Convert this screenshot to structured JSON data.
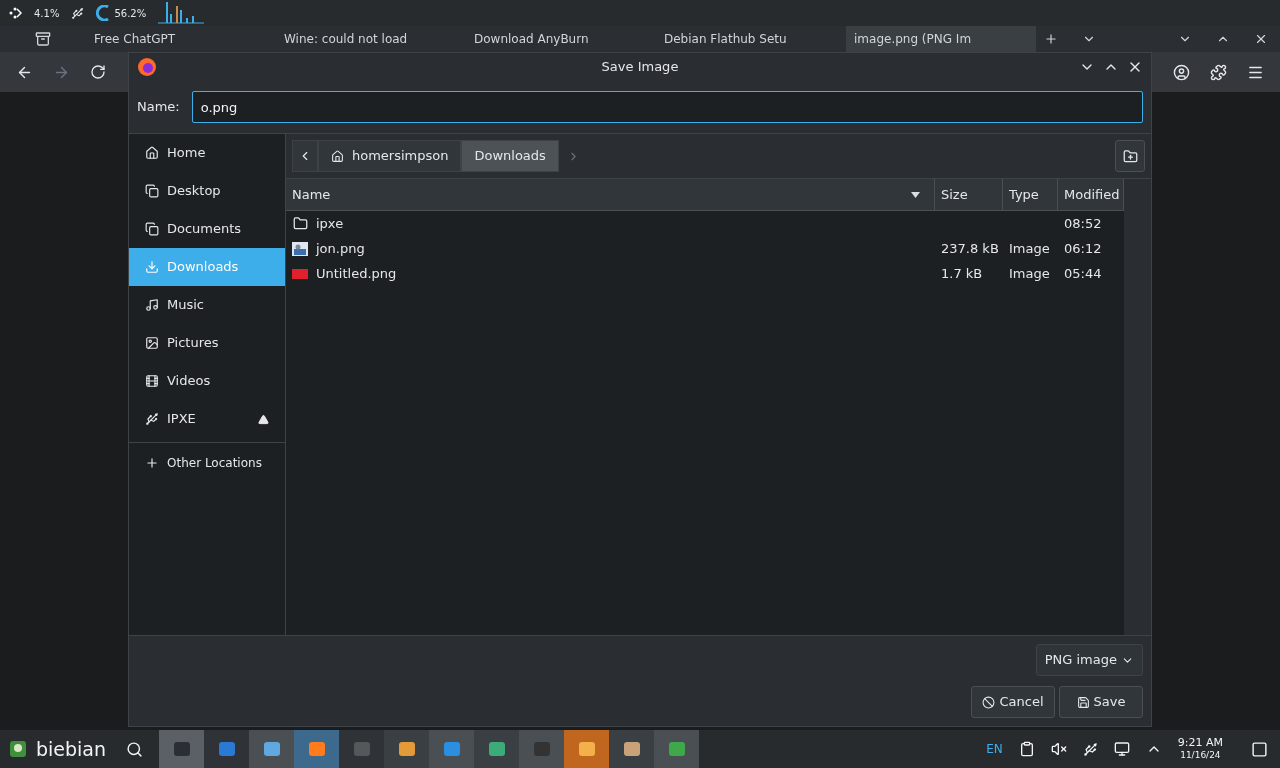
{
  "top_panel": {
    "cpu": "4.1%",
    "memory": "56.2%"
  },
  "browser_tabs": [
    {
      "label": "Free ChatGPT",
      "selected": false
    },
    {
      "label": "Wine: could not load",
      "selected": false
    },
    {
      "label": "Download AnyBurn",
      "selected": false
    },
    {
      "label": "Debian Flathub Setu",
      "selected": false
    },
    {
      "label": "image.png (PNG Im",
      "selected": true
    }
  ],
  "dialog": {
    "title": "Save Image",
    "name_label": "Name:",
    "name_value": "o.png",
    "path": [
      {
        "label": "homersimpson",
        "selected": false
      },
      {
        "label": "Downloads",
        "selected": true
      }
    ],
    "places": [
      {
        "label": "Home",
        "selected": false
      },
      {
        "label": "Desktop",
        "selected": false
      },
      {
        "label": "Documents",
        "selected": false
      },
      {
        "label": "Downloads",
        "selected": true
      },
      {
        "label": "Music",
        "selected": false
      },
      {
        "label": "Pictures",
        "selected": false
      },
      {
        "label": "Videos",
        "selected": false
      },
      {
        "label": "IPXE",
        "selected": false
      }
    ],
    "other_locations": "Other Locations",
    "columns": [
      "Name",
      "Size",
      "Type",
      "Modified"
    ],
    "files": [
      {
        "kind": "folder",
        "name": "ipxe",
        "modified": "08:52"
      },
      {
        "kind": "photo",
        "name": "jon.png",
        "size": "237.8 kB",
        "type": "Image",
        "modified": "06:12"
      },
      {
        "kind": "red-image",
        "name": "Untitled.png",
        "size": "1.7 kB",
        "type": "Image",
        "modified": "05:44"
      }
    ],
    "file_type": "PNG image",
    "cancel": "Cancel",
    "save": "Save"
  },
  "taskbar": {
    "start_label": "biebian",
    "language": "EN",
    "time": "9:21 AM",
    "date": "11/16/24"
  }
}
